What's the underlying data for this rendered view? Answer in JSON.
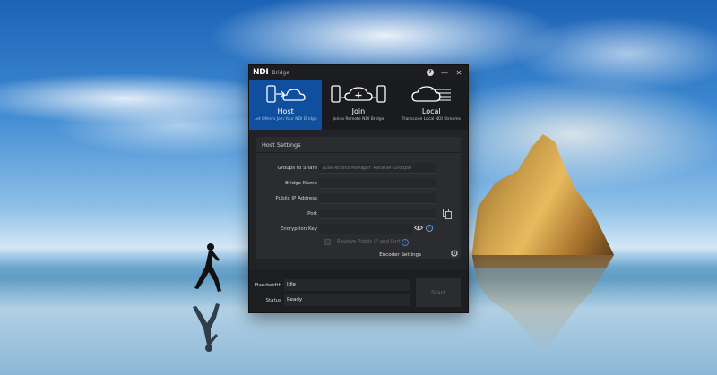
{
  "app": {
    "logo": "NDI",
    "title": "Bridge",
    "help_symbol": "?",
    "minimize_symbol": "—",
    "close_symbol": "✕"
  },
  "modes": [
    {
      "label": "Host",
      "subtitle": "Let Others Join Your NDI Bridge",
      "active": true
    },
    {
      "label": "Join",
      "subtitle": "Join a Remote NDI Bridge",
      "active": false
    },
    {
      "label": "Local",
      "subtitle": "Transcode Local NDI Streams",
      "active": false
    }
  ],
  "settings": {
    "title": "Host Settings",
    "groups_label": "Groups to Share",
    "groups_placeholder": "(Use Access Manager 'Receive' Groups)",
    "bridge_name_label": "Bridge Name",
    "public_ip_label": "Public IP Address",
    "port_label": "Port",
    "encryption_key_label": "Encryption Key",
    "resolve_label": "Resolve Public IP and Port",
    "encoder_settings_label": "Encoder Settings",
    "info_symbol": "i"
  },
  "footer": {
    "bandwidth_label": "Bandwidth",
    "bandwidth_value": "Idle",
    "status_label": "Status",
    "status_value": "Ready",
    "start_label": "Start"
  },
  "colors": {
    "accent": "#0f4f9e",
    "window_bg": "#222327"
  }
}
